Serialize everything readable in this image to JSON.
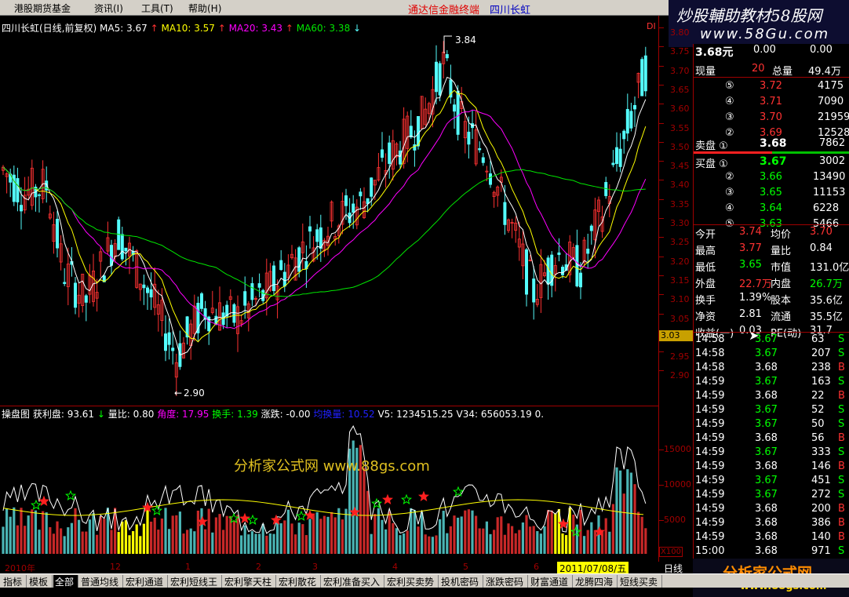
{
  "menu": {
    "items": [
      "港股期货基金",
      "资讯(I)",
      "工具(T)",
      "帮助(H)"
    ],
    "app_title": "通达信金融终端",
    "stock_title": "四川长虹"
  },
  "logo": {
    "line1": "炒股輔助教材58股网",
    "line2": "www.58Gu.com",
    "bottom_line1": "分析家公式网",
    "bottom_line2": "www.88gs.com"
  },
  "main_legend": {
    "title": "四川长虹(日线,前复权)",
    "ma5": "MA5: 3.67",
    "ma10": "MA10: 3.57",
    "ma20": "MA20: 3.43",
    "ma60": "MA60: 3.38",
    "marker": "DI",
    "high_label": "3.84",
    "low_label": "2.90"
  },
  "price_axis": {
    "ticks": [
      "3.80",
      "3.75",
      "3.70",
      "3.65",
      "3.60",
      "3.55",
      "3.50",
      "3.45",
      "3.40",
      "3.35",
      "3.30",
      "3.25",
      "3.20",
      "3.15",
      "3.10",
      "3.05",
      "3.00",
      "2.95",
      "2.90"
    ],
    "current": "3.03"
  },
  "indicator_legend": {
    "name": "操盘图",
    "items": [
      "获利盘: 93.61",
      "量比: 0.80",
      "角度: 17.95",
      "换手: 1.39",
      "涨跌: -0.00",
      "均换量: 10.52",
      "V5: 1234515.25",
      "V34: 656053.19",
      "0."
    ]
  },
  "ind_axis": {
    "ticks": [
      "15000",
      "10000",
      "5000"
    ],
    "unit": "X100"
  },
  "watermark": "分析家公式网 www.88gs.com",
  "xaxis": {
    "labels": [
      "2010年",
      "12",
      "1",
      "2",
      "3",
      "4",
      "5",
      "6"
    ],
    "date_box": "2011/07/08/五",
    "period": "日线"
  },
  "quote": {
    "price": "3.68元",
    "change": "0.00",
    "pct": "0.00",
    "now_vol_label": "现量",
    "now_vol": "20",
    "total_vol_label": "总量",
    "total_vol": "49.4万",
    "asks": [
      {
        "lvl": "⑤",
        "price": "3.72",
        "vol": "4175"
      },
      {
        "lvl": "④",
        "price": "3.71",
        "vol": "7090"
      },
      {
        "lvl": "③",
        "price": "3.70",
        "vol": "21959"
      },
      {
        "lvl": "②",
        "price": "3.69",
        "vol": "12528"
      }
    ],
    "ask1": {
      "label": "卖盘 ①",
      "price": "3.68",
      "vol": "7862"
    },
    "bid1": {
      "label": "买盘 ①",
      "price": "3.67",
      "vol": "3002"
    },
    "bids": [
      {
        "lvl": "②",
        "price": "3.66",
        "vol": "13490"
      },
      {
        "lvl": "③",
        "price": "3.65",
        "vol": "11153"
      },
      {
        "lvl": "④",
        "price": "3.64",
        "vol": "6228"
      },
      {
        "lvl": "⑤",
        "price": "3.63",
        "vol": "5466"
      }
    ],
    "stats": [
      [
        "今开",
        "3.74",
        "均价",
        "3.70"
      ],
      [
        "最高",
        "3.77",
        "量比",
        "0.84"
      ],
      [
        "最低",
        "3.65",
        "市值",
        "131.0亿"
      ],
      [
        "外盘",
        "22.7万",
        "内盘",
        "26.7万"
      ],
      [
        "换手",
        "1.39%",
        "股本",
        "35.6亿"
      ],
      [
        "净资",
        "2.81",
        "流通",
        "35.5亿"
      ],
      [
        "收益(一)",
        "0.03",
        "PE(动)",
        "31.7"
      ]
    ],
    "ticks": [
      [
        "14:58",
        "3.67",
        "63",
        "S"
      ],
      [
        "14:58",
        "3.67",
        "207",
        "S"
      ],
      [
        "14:58",
        "3.68",
        "238",
        "B"
      ],
      [
        "14:59",
        "3.67",
        "163",
        "S"
      ],
      [
        "14:59",
        "3.68",
        "22",
        "B"
      ],
      [
        "14:59",
        "3.67",
        "52",
        "S"
      ],
      [
        "14:59",
        "3.67",
        "50",
        "S"
      ],
      [
        "14:59",
        "3.68",
        "56",
        "B"
      ],
      [
        "14:59",
        "3.67",
        "333",
        "S"
      ],
      [
        "14:59",
        "3.68",
        "146",
        "B"
      ],
      [
        "14:59",
        "3.67",
        "451",
        "S"
      ],
      [
        "14:59",
        "3.67",
        "272",
        "S"
      ],
      [
        "14:59",
        "3.68",
        "200",
        "B"
      ],
      [
        "14:59",
        "3.68",
        "386",
        "B"
      ],
      [
        "14:59",
        "3.68",
        "140",
        "B"
      ],
      [
        "15:00",
        "3.68",
        "971",
        "S"
      ]
    ]
  },
  "tabs": [
    "指标",
    "模板",
    "全部",
    "普通均线",
    "宏利通道",
    "宏利短线王",
    "宏利擎天柱",
    "宏利散花",
    "宏利准备买入",
    "宏利买卖势",
    "投机密码",
    "涨跌密码",
    "财富通道",
    "龙腾四海",
    "短线买卖"
  ],
  "colors": {
    "up": "#ff3232",
    "down": "#54fcfc",
    "ma5": "#ffffff",
    "ma10": "#ffff00",
    "ma20": "#ff00ff",
    "ma60": "#00e600",
    "axis": "#a00000",
    "yellow": "#ffff00",
    "green": "#00ff00"
  }
}
